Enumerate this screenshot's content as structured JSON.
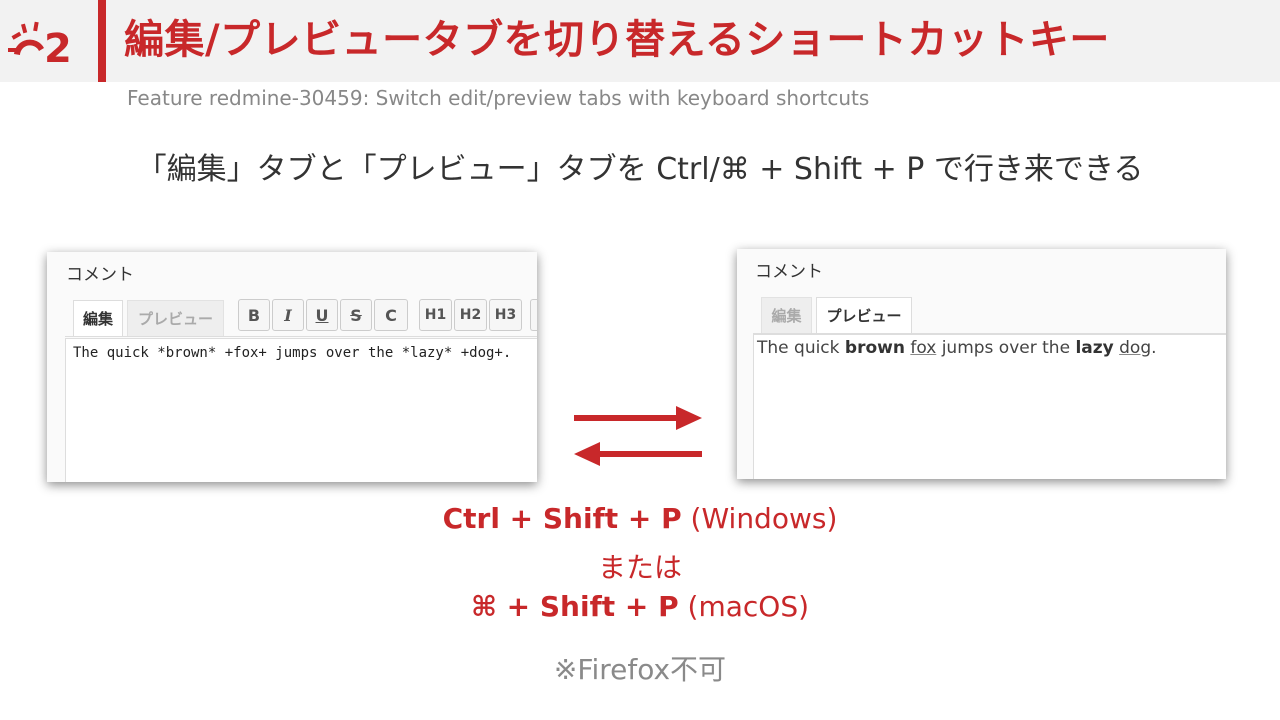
{
  "header": {
    "title": "編集/プレビュータブを切り替えるショートカットキー",
    "subtitle": "Feature redmine-30459: Switch edit/preview tabs with keyboard shortcuts",
    "accent_color": "#c8282a",
    "logo_icon": "redmine-logo-icon"
  },
  "lead": "「編集」タブと「プレビュー」タブを Ctrl/⌘ + Shift + P で行き来できる",
  "left_panel": {
    "label": "コメント",
    "tabs": [
      {
        "label": "編集",
        "active": true
      },
      {
        "label": "プレビュー",
        "active": false
      }
    ],
    "toolbar": [
      {
        "label": "B",
        "icon": "bold-icon"
      },
      {
        "label": "I",
        "icon": "italic-icon"
      },
      {
        "label": "U",
        "icon": "underline-icon"
      },
      {
        "label": "S",
        "icon": "strikethrough-icon"
      },
      {
        "label": "C",
        "icon": "code-icon"
      },
      {
        "label": "H1",
        "icon": "heading1-icon"
      },
      {
        "label": "H2",
        "icon": "heading2-icon"
      },
      {
        "label": "H3",
        "icon": "heading3-icon"
      }
    ],
    "text": "The quick *brown* +fox+ jumps over the *lazy* +dog+."
  },
  "right_panel": {
    "label": "コメント",
    "tabs": [
      {
        "label": "編集",
        "active": false
      },
      {
        "label": "プレビュー",
        "active": true
      }
    ],
    "preview": {
      "t1": "The quick ",
      "brown": "brown",
      "fox": "fox",
      "t2": " jumps over the ",
      "lazy": "lazy",
      "dog": "dog",
      "t3": "."
    }
  },
  "arrows_icon": "swap-arrows-icon",
  "shortcuts": {
    "windows_keys": "Ctrl + Shift + P",
    "windows_os": " (Windows)",
    "or": "または",
    "mac_keys": "⌘ + Shift + P",
    "mac_os": " (macOS)"
  },
  "note": "※Firefox不可"
}
